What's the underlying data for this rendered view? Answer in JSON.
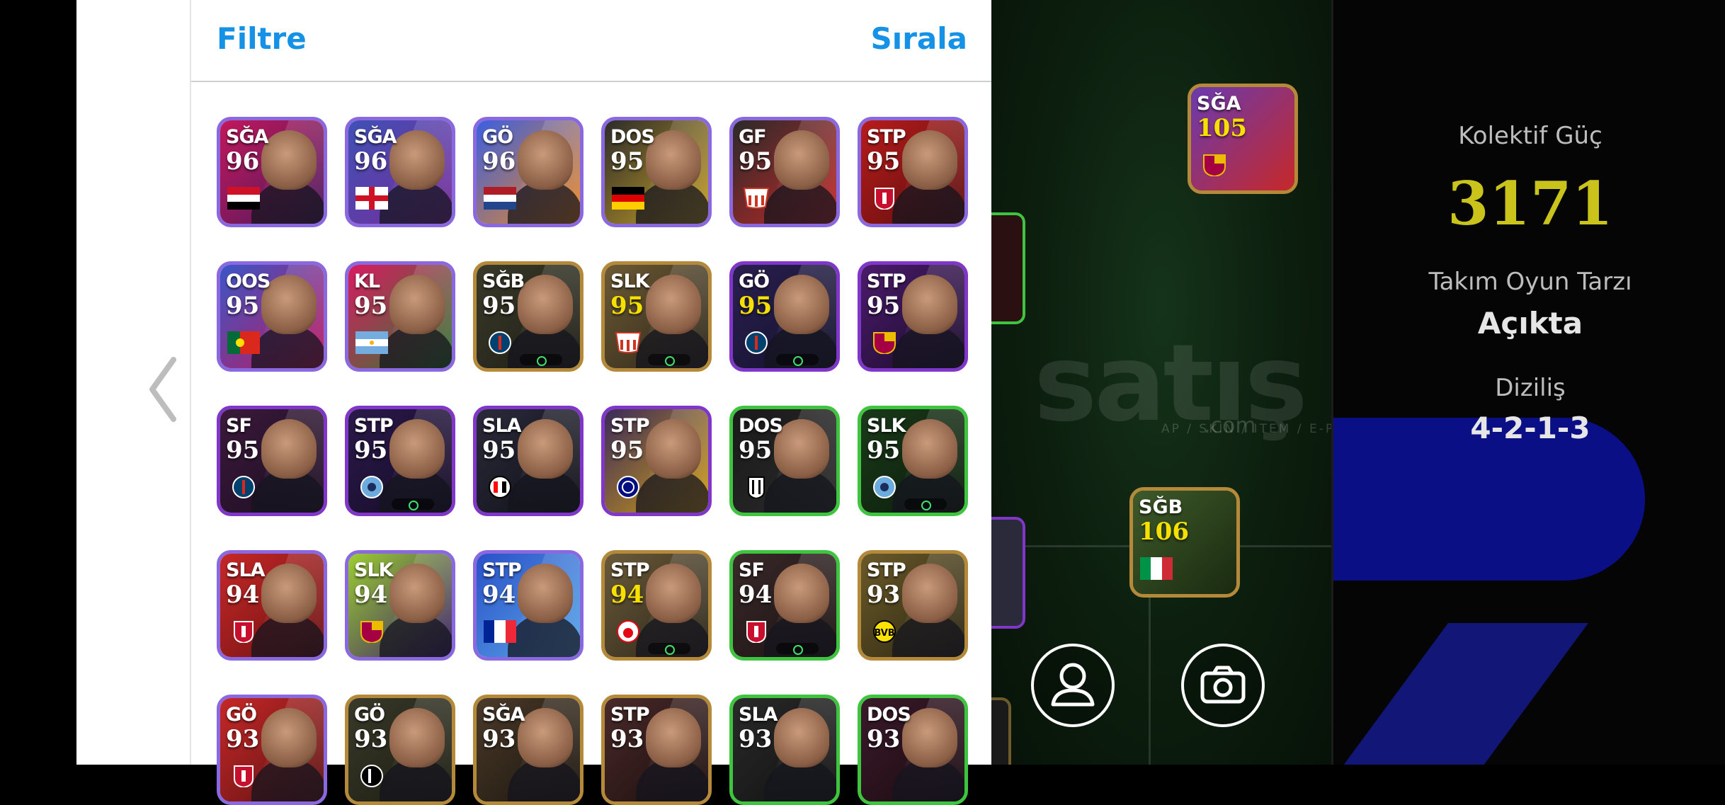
{
  "header": {
    "filter_label": "Filtre",
    "sort_label": "Sırala"
  },
  "cards": [
    {
      "pos": "SĞA",
      "ovr": "96",
      "frame": "#8a68e0",
      "bg": [
        "#c2185b",
        "#4a1a5e"
      ],
      "flag": "egypt"
    },
    {
      "pos": "SĞA",
      "ovr": "96",
      "frame": "#8a68e0",
      "bg": [
        "#3f51b5",
        "#7a2b9a"
      ],
      "flag": "england"
    },
    {
      "pos": "GÖ",
      "ovr": "96",
      "frame": "#8a68e0",
      "bg": [
        "#3b5fe0",
        "#f08a1e"
      ],
      "flag": "netherlands"
    },
    {
      "pos": "DOS",
      "ovr": "95",
      "frame": "#8a68e0",
      "bg": [
        "#2b2b2b",
        "#c9a227"
      ],
      "flag": "germany"
    },
    {
      "pos": "GF",
      "ovr": "95",
      "frame": "#8a68e0",
      "bg": [
        "#2a2a2a",
        "#c62828"
      ],
      "flag": "atletico"
    },
    {
      "pos": "STP",
      "ovr": "95",
      "frame": "#8a68e0",
      "bg": [
        "#b71c1c",
        "#5a0d0d"
      ],
      "flag": "liverpool"
    },
    {
      "pos": "OOS",
      "ovr": "95",
      "frame": "#8a68e0",
      "bg": [
        "#3a56c8",
        "#c2185b"
      ],
      "flag": "portugal"
    },
    {
      "pos": "KL",
      "ovr": "95",
      "frame": "#8a68e0",
      "bg": [
        "#d81b60",
        "#2e7d32"
      ],
      "flag": "argentina"
    },
    {
      "pos": "SĞB",
      "ovr": "95",
      "frame": "#b48a3a",
      "bg": [
        "#3a3a2a",
        "#1c1c14"
      ],
      "flag": "psg",
      "skill": true
    },
    {
      "pos": "SLK",
      "ovr": "95",
      "frame": "#b48a3a",
      "bg": [
        "#6d5a35",
        "#2a2418"
      ],
      "flag": "atletico",
      "skill": true,
      "yellow": true
    },
    {
      "pos": "GÖ",
      "ovr": "95",
      "frame": "#7f36c9",
      "bg": [
        "#2a2050",
        "#12102a"
      ],
      "flag": "psg",
      "skill": true,
      "yellow": true
    },
    {
      "pos": "STP",
      "ovr": "95",
      "frame": "#7f36c9",
      "bg": [
        "#4a1c6a",
        "#1a0a2a"
      ],
      "flag": "barcelona"
    },
    {
      "pos": "SF",
      "ovr": "95",
      "frame": "#7f36c9",
      "bg": [
        "#3a1a3a",
        "#1c0c22"
      ],
      "flag": "psg"
    },
    {
      "pos": "STP",
      "ovr": "95",
      "frame": "#7f36c9",
      "bg": [
        "#2a1a4a",
        "#140a24"
      ],
      "flag": "mancity",
      "skill": true
    },
    {
      "pos": "SLA",
      "ovr": "95",
      "frame": "#7f36c9",
      "bg": [
        "#2a2a3a",
        "#101018"
      ],
      "flag": "milan"
    },
    {
      "pos": "STP",
      "ovr": "95",
      "frame": "#7f36c9",
      "bg": [
        "#3a2a5a",
        "#d4a017"
      ],
      "flag": "inter"
    },
    {
      "pos": "DOS",
      "ovr": "95",
      "frame": "#3ec43e",
      "bg": [
        "#1a1a1a",
        "#2a2a2a"
      ],
      "flag": "juventus"
    },
    {
      "pos": "SLK",
      "ovr": "95",
      "frame": "#3ec43e",
      "bg": [
        "#1a3a1a",
        "#0a1a0a"
      ],
      "flag": "mancity",
      "skill": true
    },
    {
      "pos": "SLA",
      "ovr": "94",
      "frame": "#8a68e0",
      "bg": [
        "#c62828",
        "#6a1010"
      ],
      "flag": "liverpool"
    },
    {
      "pos": "SLK",
      "ovr": "94",
      "frame": "#8a68e0",
      "bg": [
        "#9acd32",
        "#3a1a6a"
      ],
      "flag": "barcelona"
    },
    {
      "pos": "STP",
      "ovr": "94",
      "frame": "#8a68e0",
      "bg": [
        "#2a50c8",
        "#5aa8e8"
      ],
      "flag": "france"
    },
    {
      "pos": "STP",
      "ovr": "94",
      "frame": "#b48a3a",
      "bg": [
        "#6a5a3a",
        "#2a2418"
      ],
      "flag": "benfica",
      "skill": true,
      "yellow": true
    },
    {
      "pos": "SF",
      "ovr": "94",
      "frame": "#3ec43e",
      "bg": [
        "#3a2a2a",
        "#1a1010"
      ],
      "flag": "liverpool",
      "skill": true
    },
    {
      "pos": "STP",
      "ovr": "93",
      "frame": "#b48a3a",
      "bg": [
        "#6a5a2a",
        "#2a2410"
      ],
      "flag": "dortmund"
    },
    {
      "pos": "GÖ",
      "ovr": "93",
      "frame": "#8a68e0",
      "bg": [
        "#c62828",
        "#5a1010"
      ],
      "flag": "liverpool"
    },
    {
      "pos": "GÖ",
      "ovr": "93",
      "frame": "#b48a3a",
      "bg": [
        "#3a3a2a",
        "#1a1a10"
      ],
      "flag": "newcastle"
    },
    {
      "pos": "SĞA",
      "ovr": "93",
      "frame": "#b48a3a",
      "bg": [
        "#4a3a2a",
        "#1a140c"
      ],
      "flag": "none"
    },
    {
      "pos": "STP",
      "ovr": "93",
      "frame": "#b48a3a",
      "bg": [
        "#4a2a2a",
        "#1a0c0c"
      ],
      "flag": "none"
    },
    {
      "pos": "SLA",
      "ovr": "93",
      "frame": "#3ec43e",
      "bg": [
        "#2a2a2a",
        "#101010"
      ],
      "flag": "none"
    },
    {
      "pos": "DOS",
      "ovr": "93",
      "frame": "#3ec43e",
      "bg": [
        "#3a1a2a",
        "#1a0a10"
      ],
      "flag": "none"
    }
  ],
  "pitch": {
    "watermark": "satış",
    "watermark_sub": "AP / SKIN / ITEM / E-PIN",
    "watermark_com": ".com",
    "cards": [
      {
        "pos": "SĞA",
        "ovr": "105",
        "frame": "#b48a3a",
        "bg": [
          "#6a3ab0",
          "#c62828"
        ],
        "flag": "barcelona"
      },
      {
        "pos": "SĞB",
        "ovr": "106",
        "frame": "#b48a3a",
        "bg": [
          "#3e5a2a",
          "#1a2a10"
        ],
        "flag": "italy"
      }
    ]
  },
  "info": {
    "power_label": "Kolektif Güç",
    "power_value": "3171",
    "style_label": "Takım Oyun Tarzı",
    "style_value": "Açıkta",
    "formation_label": "Diziliş",
    "formation_value": "4-2-1-3"
  },
  "colors": {
    "accent": "#1592e6",
    "power": "#c9c31c"
  }
}
